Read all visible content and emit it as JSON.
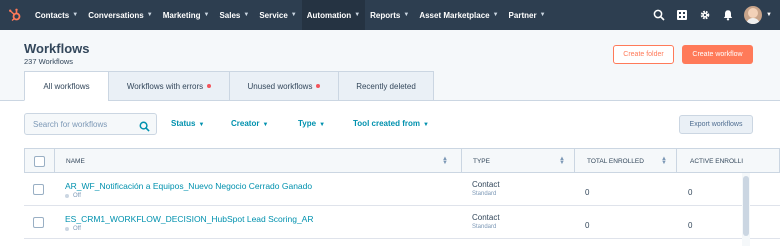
{
  "nav": {
    "logo_icon": "hubspot-sprocket-icon",
    "items": [
      {
        "label": "Contacts",
        "active": false
      },
      {
        "label": "Conversations",
        "active": false
      },
      {
        "label": "Marketing",
        "active": false
      },
      {
        "label": "Sales",
        "active": false
      },
      {
        "label": "Service",
        "active": false
      },
      {
        "label": "Automation",
        "active": true
      },
      {
        "label": "Reports",
        "active": false
      },
      {
        "label": "Asset Marketplace",
        "active": false
      },
      {
        "label": "Partner",
        "active": false
      }
    ],
    "right_icons": [
      "search-icon",
      "marketplace-icon",
      "settings-icon",
      "notifications-icon",
      "avatar"
    ]
  },
  "header": {
    "title": "Workflows",
    "subtitle": "237 Workflows",
    "create_folder": "Create folder",
    "create_workflow": "Create workflow"
  },
  "tabs": [
    {
      "label": "All workflows",
      "active": true,
      "alert": false
    },
    {
      "label": "Workflows with errors",
      "active": false,
      "alert": true
    },
    {
      "label": "Unused workflows",
      "active": false,
      "alert": true
    },
    {
      "label": "Recently deleted",
      "active": false,
      "alert": false
    }
  ],
  "filters": {
    "search_placeholder": "Search for workflows",
    "status": "Status",
    "creator": "Creator",
    "type": "Type",
    "tool": "Tool created from",
    "export": "Export workflows"
  },
  "table": {
    "columns": [
      "NAME",
      "TYPE",
      "TOTAL ENROLLED",
      "ACTIVE ENROLLI"
    ],
    "rows": [
      {
        "name": "AR_WF_Notificación a Equipos_Nuevo Negocio Cerrado Ganado",
        "status": "Off",
        "type": "Contact",
        "type_sub": "Standard",
        "total": "0",
        "active": "0"
      },
      {
        "name": "ES_CRM1_WORKFLOW_DECISION_HubSpot Lead Scoring_AR",
        "status": "Off",
        "type": "Contact",
        "type_sub": "Standard",
        "total": "0",
        "active": "0"
      }
    ]
  },
  "colors": {
    "nav_bg": "#2d3e50",
    "accent": "#ff7a59",
    "link": "#0091ae",
    "alert": "#f2545b"
  }
}
